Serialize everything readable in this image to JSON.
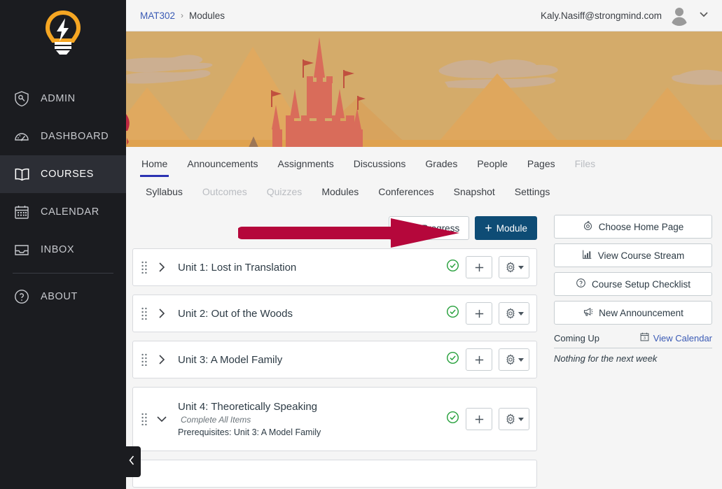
{
  "globalnav": {
    "logo_icon": "lightbulb-logo",
    "logo_colors": {
      "bulb": "#f5a623",
      "bolt": "#ffffff"
    },
    "items": [
      {
        "label": "ADMIN",
        "icon": "shield-wrench-icon",
        "active": false
      },
      {
        "label": "DASHBOARD",
        "icon": "gauge-icon",
        "active": false
      },
      {
        "label": "COURSES",
        "icon": "open-book-icon",
        "active": true
      },
      {
        "label": "CALENDAR",
        "icon": "calendar-icon",
        "active": false
      },
      {
        "label": "INBOX",
        "icon": "inbox-tray-icon",
        "active": false
      },
      {
        "label": "ABOUT",
        "icon": "question-circle-icon",
        "active": false
      }
    ],
    "collapse_icon": "chevron-left-icon"
  },
  "topbar": {
    "breadcrumb": {
      "course": "MAT302",
      "separator": "›",
      "current": "Modules"
    },
    "user_email": "Kaly.Nasiff@strongmind.com",
    "avatar_icon": "user-avatar-icon",
    "dropdown_icon": "chevron-down-icon"
  },
  "banner": {
    "alt": "course-banner-castle-mountains",
    "colors": {
      "sky": "#d4ab6a",
      "mountain": "#e0a95f",
      "mountain_dark": "#d9a05a",
      "castle": "#d96c5a",
      "cloud": "#cbb098",
      "ground": "#dba martial"
    }
  },
  "coursenav": {
    "row1": [
      {
        "label": "Home",
        "state": "active"
      },
      {
        "label": "Announcements",
        "state": "normal"
      },
      {
        "label": "Assignments",
        "state": "normal"
      },
      {
        "label": "Discussions",
        "state": "normal"
      },
      {
        "label": "Grades",
        "state": "normal"
      },
      {
        "label": "People",
        "state": "normal"
      },
      {
        "label": "Pages",
        "state": "normal"
      },
      {
        "label": "Files",
        "state": "disabled"
      }
    ],
    "row2": [
      {
        "label": "Syllabus",
        "state": "normal"
      },
      {
        "label": "Outcomes",
        "state": "disabled"
      },
      {
        "label": "Quizzes",
        "state": "disabled"
      },
      {
        "label": "Modules",
        "state": "normal"
      },
      {
        "label": "Conferences",
        "state": "normal"
      },
      {
        "label": "Snapshot",
        "state": "normal"
      },
      {
        "label": "Settings",
        "state": "normal"
      }
    ]
  },
  "actions": {
    "view_progress_label": "View Progress",
    "add_module_label": "Module",
    "add_module_plus": "+",
    "annotation": {
      "type": "arrow",
      "color": "#b5073b",
      "points_to": "view-progress-button",
      "direction": "right"
    }
  },
  "modules": [
    {
      "title": "Unit 1: Lost in Translation",
      "expanded": false,
      "subtitle": "",
      "prerequisites": "",
      "published": true,
      "drag_icon": "drag-handle-icon",
      "chevron_icon": "chevron-right-icon",
      "publish_icon": "published-check-icon",
      "add_icon": "plus-icon",
      "settings_icon": "gear-icon"
    },
    {
      "title": "Unit 2: Out of the Woods",
      "expanded": false,
      "subtitle": "",
      "prerequisites": "",
      "published": true,
      "drag_icon": "drag-handle-icon",
      "chevron_icon": "chevron-right-icon",
      "publish_icon": "published-check-icon",
      "add_icon": "plus-icon",
      "settings_icon": "gear-icon"
    },
    {
      "title": "Unit 3: A Model Family",
      "expanded": false,
      "subtitle": "",
      "prerequisites": "",
      "published": true,
      "drag_icon": "drag-handle-icon",
      "chevron_icon": "chevron-right-icon",
      "publish_icon": "published-check-icon",
      "add_icon": "plus-icon",
      "settings_icon": "gear-icon"
    },
    {
      "title": "Unit 4: Theoretically Speaking",
      "expanded": true,
      "subtitle": "Complete All Items",
      "prerequisites": "Prerequisites: Unit 3: A Model Family",
      "published": true,
      "drag_icon": "drag-handle-icon",
      "chevron_icon": "chevron-down-icon",
      "publish_icon": "published-check-icon",
      "add_icon": "plus-icon",
      "settings_icon": "gear-icon"
    }
  ],
  "sidebar_right": {
    "buttons": [
      {
        "label": "Choose Home Page",
        "icon": "target-icon"
      },
      {
        "label": "View Course Stream",
        "icon": "bar-chart-icon"
      },
      {
        "label": "Course Setup Checklist",
        "icon": "question-circle-icon"
      },
      {
        "label": "New Announcement",
        "icon": "megaphone-icon"
      }
    ],
    "coming_up": {
      "title": "Coming Up",
      "view_calendar_label": "View Calendar",
      "calendar_icon": "calendar-3-icon",
      "empty_text": "Nothing for the next week"
    }
  },
  "colors": {
    "accent_blue": "#2b32b2",
    "primary_button": "#0e4c75",
    "link": "#3b5bb5",
    "published_green": "#27a03c",
    "annotation_red": "#b5073b",
    "nav_bg": "#1b1c20"
  }
}
